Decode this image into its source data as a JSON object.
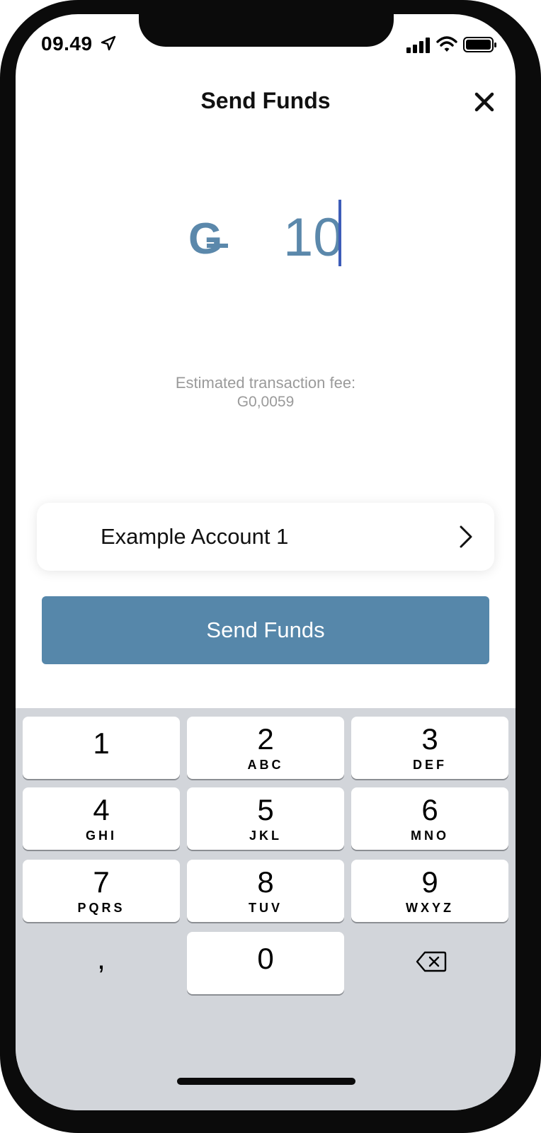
{
  "status_bar": {
    "time": "09.49"
  },
  "header": {
    "title": "Send Funds"
  },
  "amount": {
    "currency_symbol": "G",
    "value": "10"
  },
  "fee": {
    "label": "Estimated transaction fee:",
    "value": "G0,0059"
  },
  "account": {
    "name": "Example Account 1"
  },
  "send_button": {
    "label": "Send Funds"
  },
  "keyboard": {
    "keys": [
      {
        "digit": "1",
        "letters": ""
      },
      {
        "digit": "2",
        "letters": "ABC"
      },
      {
        "digit": "3",
        "letters": "DEF"
      },
      {
        "digit": "4",
        "letters": "GHI"
      },
      {
        "digit": "5",
        "letters": "JKL"
      },
      {
        "digit": "6",
        "letters": "MNO"
      },
      {
        "digit": "7",
        "letters": "PQRS"
      },
      {
        "digit": "8",
        "letters": "TUV"
      },
      {
        "digit": "9",
        "letters": "WXYZ"
      },
      {
        "digit": ",",
        "letters": ""
      },
      {
        "digit": "0",
        "letters": ""
      }
    ]
  },
  "colors": {
    "accent": "#5687aa",
    "amount_text": "#5b88ab",
    "caret": "#3d5cb8",
    "keyboard_bg": "#d2d5da"
  }
}
